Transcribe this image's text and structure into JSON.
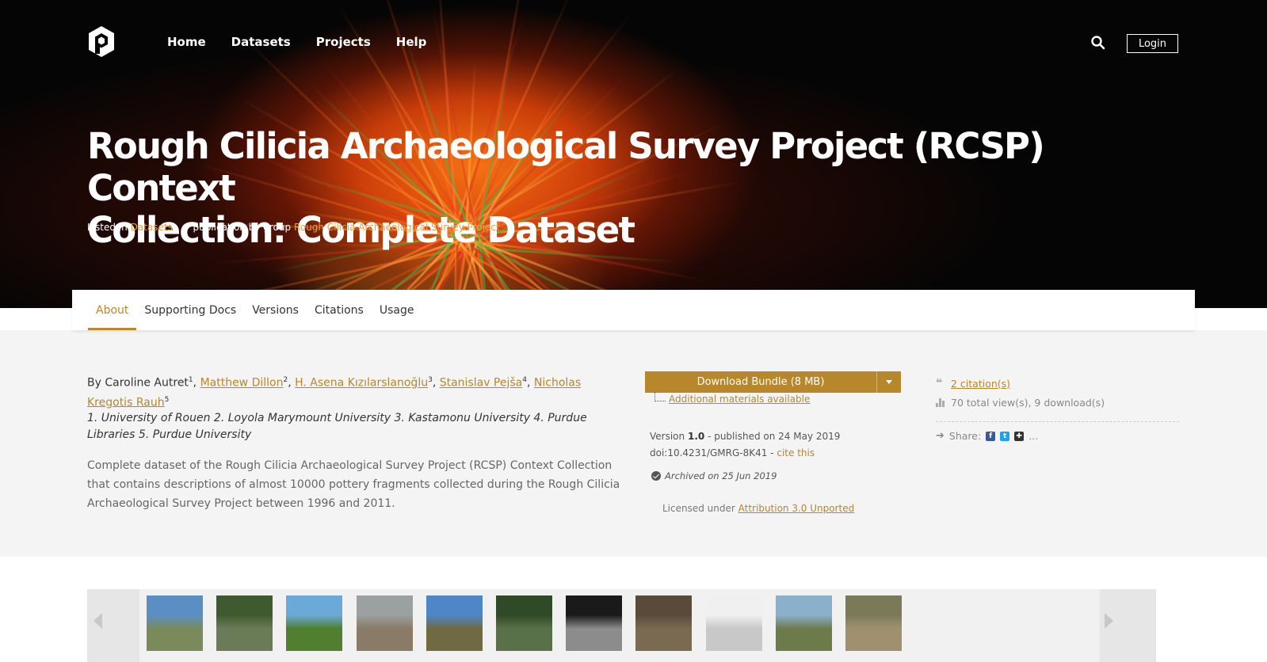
{
  "header": {
    "nav": [
      "Home",
      "Datasets",
      "Projects",
      "Help"
    ],
    "login_label": "Login"
  },
  "hero": {
    "title_line1": "Rough Cilicia Archaeological Survey Project (RCSP) Context",
    "title_line2": "Collection: Complete Dataset",
    "listed_prefix": "Listed in",
    "listed_link": "Datasets",
    "publication_prefix": "publication by group",
    "publication_link": "Rough Cilicia Archaeological Survey Project"
  },
  "tabs": [
    "About",
    "Supporting Docs",
    "Versions",
    "Citations",
    "Usage"
  ],
  "authors": {
    "by": "By",
    "list": [
      {
        "name": "Caroline Autret",
        "sup": "1",
        "link": false
      },
      {
        "name": "Matthew Dillon",
        "sup": "2",
        "link": true
      },
      {
        "name": "H. Asena Kızılarslanoğlu",
        "sup": "3",
        "link": true
      },
      {
        "name": "Stanislav Pejša",
        "sup": "4",
        "link": true
      },
      {
        "name": "Nicholas Kregotis Rauh",
        "sup": "5",
        "link": true
      }
    ],
    "affiliations": "1. University of Rouen 2. Loyola Marymount University 3. Kastamonu University 4. Purdue Libraries 5. Purdue University"
  },
  "abstract": "Complete dataset of the Rough Cilicia Archaeological Survey Project (RCSP) Context Collection that contains descriptions of almost 10000 pottery fragments collected during the Rough Cilicia Archaeological Survey Project between 1996 and 2011.",
  "download": {
    "label": "Download Bundle (8 MB)",
    "additional": "Additional materials available"
  },
  "version": {
    "prefix": "Version",
    "number": "1.0",
    "published": "- published on 24 May 2019",
    "doi": "doi:10.4231/GMRG-8K41 -",
    "cite": "cite this",
    "archived": "Archived on 25 Jun 2019",
    "license_prefix": "Licensed under",
    "license": "Attribution 3.0 Unported"
  },
  "stats": {
    "citations": "2 citation(s)",
    "views": "70 total view(s), 9 download(s)",
    "share_label": "Share:",
    "share_more": "..."
  },
  "colors": {
    "accent": "#b8862b",
    "hero_link": "#e8a14a",
    "background": "#f4f4f4"
  },
  "thumbnails": [
    {
      "sky": "#5b8fc4",
      "ground": "#7a8a5a"
    },
    {
      "sky": "#3e5a2e",
      "ground": "#6b7b58"
    },
    {
      "sky": "#6aa9d8",
      "ground": "#4f7f2f"
    },
    {
      "sky": "#9aa1a0",
      "ground": "#8a7a68"
    },
    {
      "sky": "#4f86c6",
      "ground": "#6f6a42"
    },
    {
      "sky": "#2f4a26",
      "ground": "#5a7048"
    },
    {
      "sky": "#1a1a1a",
      "ground": "#8c8c8c"
    },
    {
      "sky": "#5a4a3a",
      "ground": "#7a6a52"
    },
    {
      "sky": "#f0f0f0",
      "ground": "#c8c8c8"
    },
    {
      "sky": "#8ab0cc",
      "ground": "#6d7a4a"
    },
    {
      "sky": "#7a7a5a",
      "ground": "#a09070"
    }
  ]
}
